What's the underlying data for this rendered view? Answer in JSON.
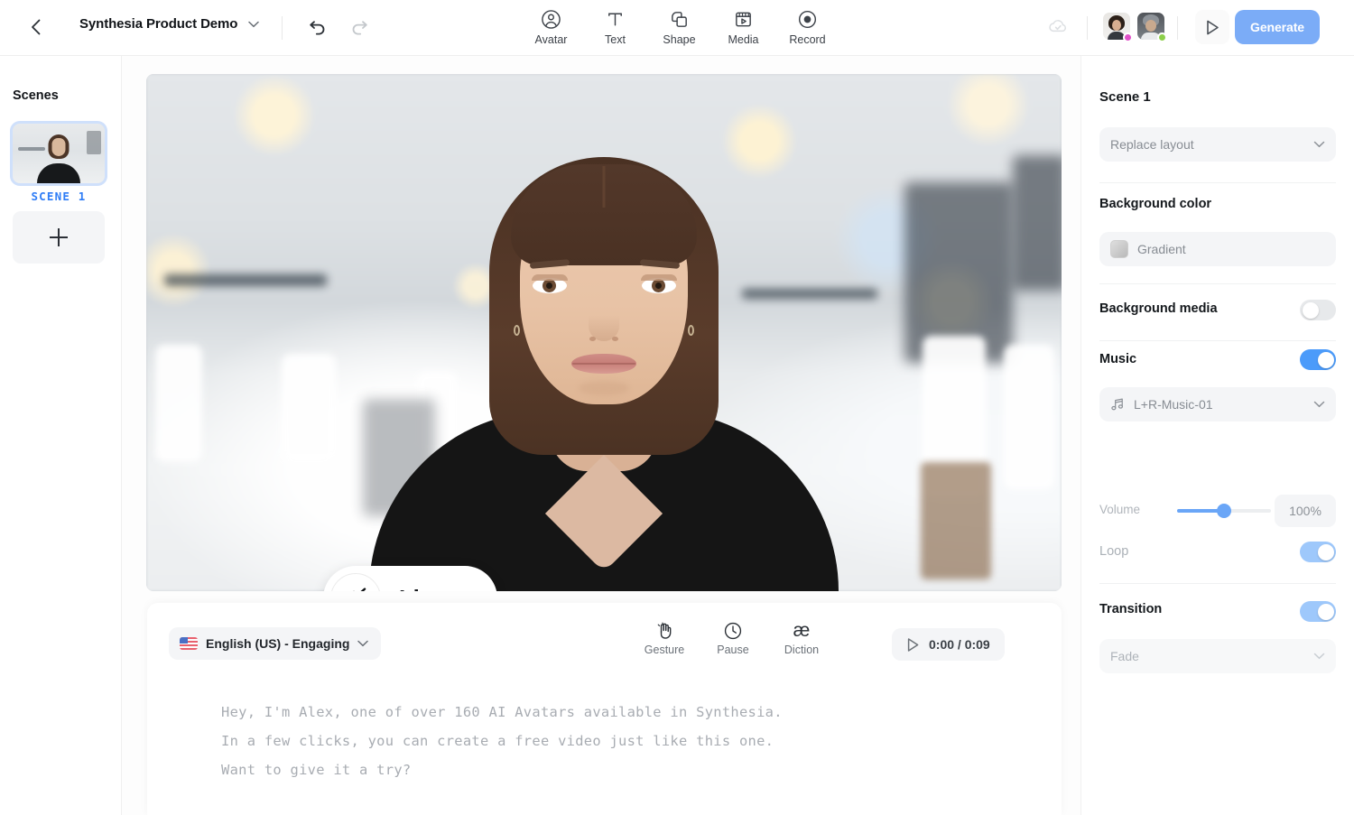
{
  "topbar": {
    "back_icon": "chevron-left-icon",
    "project_title": "Synthesia Product Demo",
    "title_caret": "chevron-down-icon",
    "undo_icon": "undo-icon",
    "redo_icon": "redo-icon",
    "sync_icon": "cloud-sync-icon",
    "preview_icon": "play-triangle-icon",
    "generate_label": "Generate",
    "tools": [
      {
        "label": "Avatar",
        "icon": "avatar-person-icon"
      },
      {
        "label": "Text",
        "icon": "text-t-icon"
      },
      {
        "label": "Shape",
        "icon": "shape-square-icon"
      },
      {
        "label": "Media",
        "icon": "media-clapper-icon"
      },
      {
        "label": "Record",
        "icon": "record-dot-icon"
      }
    ],
    "collaborators": [
      {
        "name": "collaborator-1",
        "status_color": "#e050c8"
      },
      {
        "name": "collaborator-2",
        "status_color": "#8ccf4a"
      }
    ],
    "generate_color": "#7bacf7"
  },
  "sidebar": {
    "title": "Scenes",
    "scene_label": "SCENE 1",
    "scene_label_color": "#2f7df6",
    "add_scene_icon": "plus-icon"
  },
  "canvas": {
    "listen_label": "Listen",
    "listen_icon": "speaker-muted-icon"
  },
  "script": {
    "voice_label": "English (US) - Engaging",
    "voice_flag_icon": "us-flag-icon",
    "voice_caret": "chevron-down-icon",
    "tools": [
      {
        "label": "Gesture",
        "icon": "hand-wave-icon"
      },
      {
        "label": "Pause",
        "icon": "clock-icon"
      },
      {
        "label": "Diction",
        "icon": "ae-ligature-icon"
      }
    ],
    "play_icon": "play-triangle-icon",
    "time": "0:00 / 0:09",
    "text": "Hey, I'm Alex, one of over 160 AI Avatars available in Synthesia.\nIn a few clicks, you can create a free video just like this one.\nWant to give it a try?"
  },
  "right_panel": {
    "scene_title": "Scene 1",
    "replace_layout": "Replace layout",
    "background_color_label": "Background color",
    "gradient_value": "Gradient",
    "background_media_label": "Background media",
    "background_media_on": false,
    "music_label": "Music",
    "music_on": true,
    "music_track": "L+R-Music-01",
    "music_icon": "music-note-icon",
    "volume_label": "Volume",
    "volume_value": "100%",
    "loop_label": "Loop",
    "loop_on": true,
    "transition_label": "Transition",
    "transition_on": true,
    "transition_value": "Fade",
    "caret_icon": "chevron-down-icon",
    "accent_color": "#4b9bfa"
  }
}
